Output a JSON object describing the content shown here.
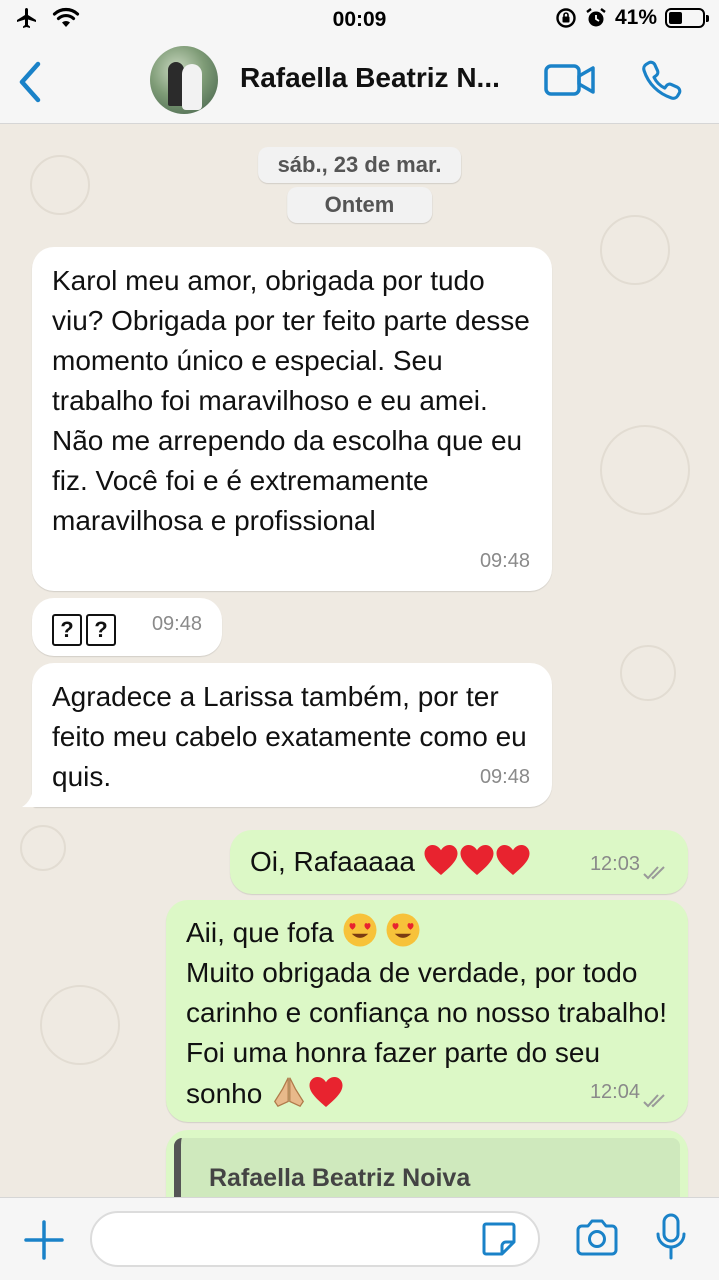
{
  "status_bar": {
    "time": "00:09",
    "battery_percent_label": "41%",
    "battery_level": 0.41
  },
  "header": {
    "contact_name": "Rafaella Beatriz N...",
    "icons": [
      "back-chevron-icon",
      "video-call-icon",
      "phone-call-icon"
    ]
  },
  "chat": {
    "date_label": "sáb., 23 de mar.",
    "day_label": "Ontem",
    "messages": [
      {
        "direction": "incoming",
        "text": "Karol meu amor, obrigada por tudo viu? Obrigada por ter feito parte desse momento único e especial. Seu trabalho foi maravilhoso e eu amei. Não me arrependo da escolha que eu fiz. Você foi e é extremamente maravilhosa e profissional",
        "time": "09:48"
      },
      {
        "direction": "incoming",
        "text": "??",
        "time": "09:48"
      },
      {
        "direction": "incoming",
        "text": "Agradece a Larissa também, por ter feito meu cabelo exatamente como eu quis.",
        "time": "09:48"
      },
      {
        "direction": "outgoing",
        "text": "Oi, Rafaaaaa",
        "time": "12:03",
        "status": "read"
      },
      {
        "direction": "outgoing",
        "line1": "Aii, que fofa",
        "text": "Muito obrigada de verdade, por todo carinho e confiança no nosso trabalho! Foi uma honra fazer parte do seu sonho",
        "time": "12:04",
        "status": "read"
      },
      {
        "direction": "outgoing",
        "quoted_name": "Rafaella Beatriz Noiva"
      }
    ]
  },
  "composer": {
    "input_value": "",
    "icons": [
      "plus-icon",
      "sticker-icon",
      "camera-icon",
      "microphone-icon"
    ]
  },
  "colors": {
    "accent": "#1a82c8",
    "chat_background": "#efeae2",
    "incoming_bubble": "#ffffff",
    "outgoing_bubble": "#dcf8c6",
    "heart": "#e8232f"
  }
}
